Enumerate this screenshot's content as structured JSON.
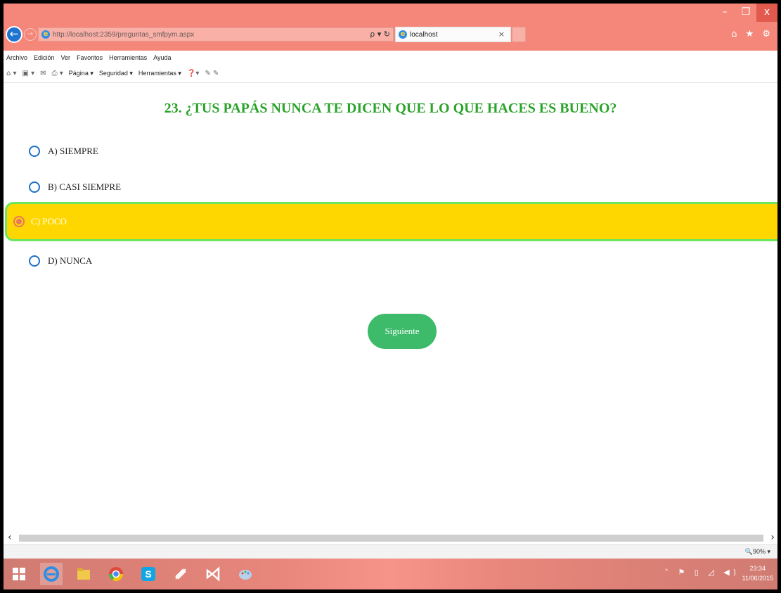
{
  "browser": {
    "window_controls": {
      "minimize": "–",
      "restore": "❐",
      "close": "x"
    },
    "back_icon": "←",
    "forward_icon": "→",
    "url": "http://localhost:2359/preguntas_smfpym.aspx",
    "address_tools": "ρ ▾ ↻",
    "tab_title": "localhost",
    "tab_close": "×",
    "right_icons": "⌂ ★ ⚙",
    "menu": [
      "Archivo",
      "Edición",
      "Ver",
      "Favoritos",
      "Herramientas",
      "Ayuda"
    ],
    "command_bar": {
      "home_icon": "⌂ ▾",
      "feeds_icon": "▣ ▾",
      "mail_icon": "✉",
      "print_icon": "⎙ ▾",
      "page": "Página ▾",
      "security": "Seguridad ▾",
      "tools": "Herramientas ▾",
      "help_icon": "❓▾",
      "extra_icons": "✎ ✎"
    },
    "status_zoom": "🔍90%  ▾"
  },
  "page": {
    "question": "23. ¿TUS PAPÁS NUNCA TE DICEN QUE LO QUE HACES ES BUENO?",
    "options": [
      {
        "label": "A) SIEMPRE",
        "selected": false
      },
      {
        "label": "B) CASI SIEMPRE",
        "selected": false
      },
      {
        "label": "C) POCO",
        "selected": true
      },
      {
        "label": "D) NUNCA",
        "selected": false
      }
    ],
    "next_button": "Siguiente",
    "accent_color": "#ffd700",
    "question_color": "#2aa32a",
    "button_color": "#3dbb6a"
  },
  "scrollbar": {
    "left": "‹",
    "right": "›"
  },
  "taskbar": {
    "apps": [
      "windows-start-icon",
      "internet-explorer-icon",
      "file-explorer-icon",
      "chrome-icon",
      "skype-icon",
      "tool-icon",
      "visual-studio-icon",
      "paint-icon"
    ],
    "tray_icons": "˄ ⚑ ▯ ◿ ◀)",
    "time": "23:34",
    "date": "11/06/2015"
  }
}
